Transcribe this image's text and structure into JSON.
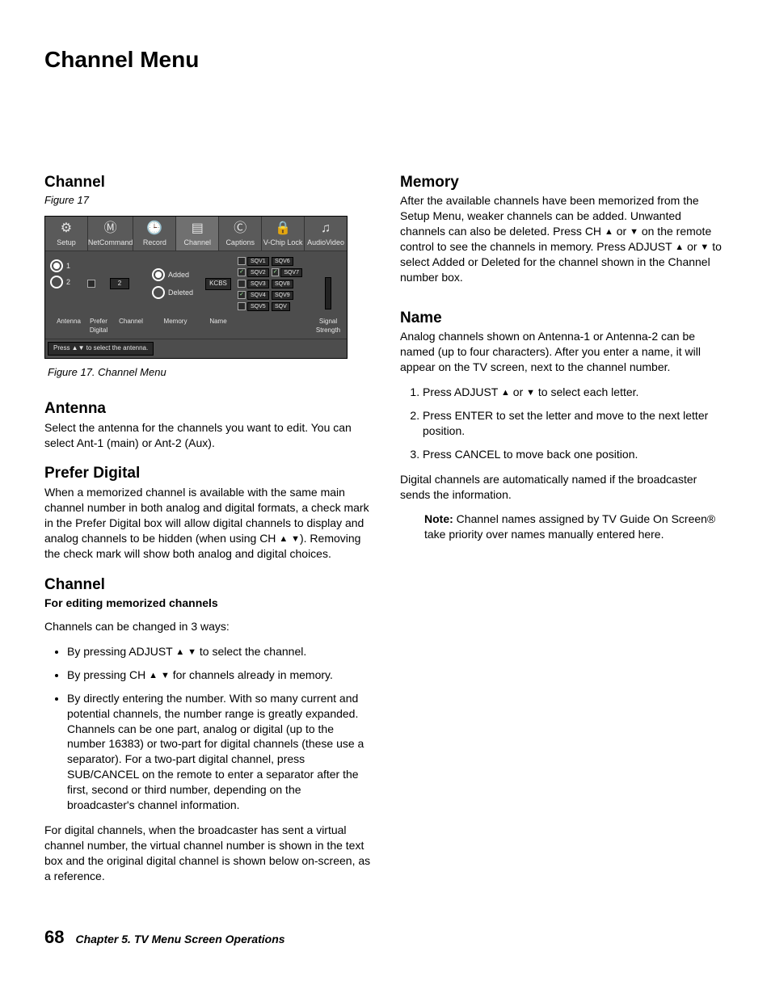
{
  "page_title": "Channel Menu",
  "left": {
    "heading1": "Channel",
    "figure_ref": "Figure 17",
    "figure_caption": "Figure 17.  Channel Menu",
    "ui": {
      "tabs": [
        "Setup",
        "NetCommand",
        "Record",
        "Channel",
        "Captions",
        "V-Chip Lock",
        "AudioVideo"
      ],
      "antenna_1": "1",
      "antenna_2": "2",
      "channel_value": "2",
      "mem_added": "Added",
      "mem_deleted": "Deleted",
      "name_value": "KCBS",
      "sqv": [
        "SQV1",
        "SQV6",
        "SQV2",
        "SQV7",
        "SQV3",
        "SQV8",
        "SQV4",
        "SQV9",
        "SQV5",
        "SQV"
      ],
      "bottom": {
        "antenna": "Antenna",
        "prefer": "Prefer Digital",
        "channel": "Channel",
        "memory": "Memory",
        "name": "Name",
        "signal": "Signal Strength"
      },
      "hint": "Press ▲▼ to select the antenna."
    },
    "antenna_h": "Antenna",
    "antenna_p": "Select the antenna for the channels you want to edit.  You can select Ant-1 (main) or Ant-2 (Aux).",
    "prefer_h": "Prefer Digital",
    "prefer_p_a": "When a memorized channel is available with the same main channel number in both analog and digital formats, a check mark in the Prefer Digital box will allow digital channels to display and analog channels to be hidden (when using CH ",
    "prefer_p_b": ").  Removing the check mark will show both analog and digital choices.",
    "channel_h": "Channel",
    "channel_sub": "For editing memorized channels",
    "channel_intro": "Channels can be changed in 3 ways:",
    "ch_b1_a": "By pressing ADJUST ",
    "ch_b1_b": " to select the channel.",
    "ch_b2_a": "By pressing CH ",
    "ch_b2_b": " for channels already in memory.",
    "ch_b3": "By directly entering the number.  With so many current and potential channels, the number range is greatly expanded.  Channels can be one part, analog or digital (up to the number 16383) or two-part for digital channels (these use a separator).  For a two-part digital channel, press SUB/CANCEL on the remote to enter a separator after the first, second or third number, depending on the broadcaster's channel information.",
    "channel_after": "For digital channels, when the broadcaster has sent a virtual channel number, the virtual channel number is shown in the text box and the original digital channel is shown below on-screen, as a reference."
  },
  "right": {
    "memory_h": "Memory",
    "memory_p_a": "After the available channels have been memorized from the Setup Menu, weaker channels can be added. Unwanted channels can also be deleted.  Press CH ",
    "memory_p_b": " or ",
    "memory_p_c": " on the remote control to see the channels in memory. Press ADJUST ",
    "memory_p_d": " or ",
    "memory_p_e": " to select Added or Deleted for the channel shown in the Channel number box.",
    "name_h": "Name",
    "name_p": "Analog channels shown on Antenna-1 or Antenna-2 can be named (up to four characters).  After you enter a name, it will appear on the TV screen, next to the channel number.",
    "name_li1_a": "Press ADJUST ",
    "name_li1_b": " or ",
    "name_li1_c": " to select each letter.",
    "name_li2": "Press ENTER  to set the letter and move to the next letter position.",
    "name_li3": "Press CANCEL to move back one position.",
    "name_after": "Digital channels are automatically named if the broadcaster sends the information.",
    "note_label": "Note:",
    "note_text": "  Channel names assigned by TV Guide On Screen® take priority over names manually entered here."
  },
  "footer": {
    "page": "68",
    "text": "Chapter 5. TV Menu Screen Operations"
  },
  "glyph": {
    "up": "▲",
    "down": "▼"
  }
}
